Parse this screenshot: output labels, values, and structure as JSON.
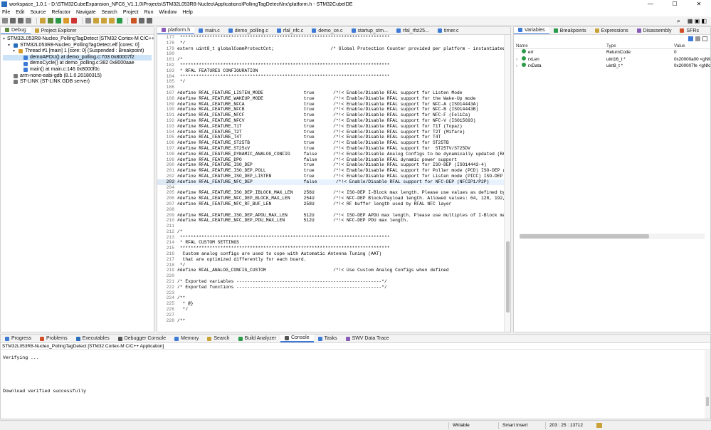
{
  "window": {
    "title": "workspace_1.0.1 - D:\\STM32CubeExpansion_NFC6_V1.1.0\\Projects\\STM32L053R8-Nucleo\\Applications\\PollingTagDetect\\Inc\\platform.h - STM32CubeIDE",
    "min": "—",
    "max": "☐",
    "close": "✕"
  },
  "menu": [
    "File",
    "Edit",
    "Source",
    "Refactor",
    "Navigate",
    "Search",
    "Project",
    "Run",
    "Window",
    "Help"
  ],
  "toolbar_icons": [
    "new-icon",
    "save-icon",
    "save-all-icon",
    "print-icon",
    "build-icon",
    "debug-icon",
    "resume-icon",
    "suspend-icon",
    "terminate-icon",
    "disconnect-icon",
    "step-into-icon",
    "step-over-icon",
    "step-return-icon",
    "run-icon",
    "external-tools-icon",
    "search-icon",
    "open-perspective-icon"
  ],
  "left_tabs": [
    {
      "label": "Debug",
      "icon_color": "#5b8a3a"
    },
    {
      "label": "Project Explorer",
      "icon_color": "#c9a23a"
    }
  ],
  "debug_tree": [
    {
      "indent": 0,
      "arrow": "▾",
      "icon_color": "#2a6ebb",
      "text": "STM32L053R8-Nucleo_PollingTagDetect [STM32 Cortex-M C/C++ Appli",
      "selected": false
    },
    {
      "indent": 1,
      "arrow": "▾",
      "icon_color": "#2a6ebb",
      "text": "STM32L053R8-Nucleo_PollingTagDetect.elf [cores: 0]",
      "selected": false
    },
    {
      "indent": 2,
      "arrow": "▾",
      "icon_color": "#d89a2a",
      "text": "Thread #1 [main] 1 [core: 0] (Suspended : Breakpoint)",
      "selected": false
    },
    {
      "indent": 3,
      "arrow": "",
      "icon_color": "#3d7ad6",
      "text": "demoAPDU() at demo_polling.c:703 0x80007f2",
      "selected": true
    },
    {
      "indent": 3,
      "arrow": "",
      "icon_color": "#3d7ad6",
      "text": "demoCycle() at demo_polling.c:382 0x8000aae",
      "selected": false
    },
    {
      "indent": 3,
      "arrow": "",
      "icon_color": "#3d7ad6",
      "text": "main() at main.c:146 0x8000f0c",
      "selected": false
    },
    {
      "indent": 1,
      "arrow": "",
      "icon_color": "#777777",
      "text": "arm-none-eabi-gdb (8.1.0.20180315)",
      "selected": false
    },
    {
      "indent": 1,
      "arrow": "",
      "icon_color": "#777777",
      "text": "ST-LINK (ST-LINK GDB server)",
      "selected": false
    }
  ],
  "editor_tabs": [
    {
      "label": "platform.h",
      "active": true
    },
    {
      "label": "main.c",
      "active": false
    },
    {
      "label": "demo_polling.c",
      "active": false
    },
    {
      "label": "rfal_nfc.c",
      "active": false
    },
    {
      "label": "demo_ce.c",
      "active": false
    },
    {
      "label": "startup_stm...",
      "active": false
    },
    {
      "label": "rfal_rfst25...",
      "active": false
    },
    {
      "label": "timer.c",
      "active": false
    }
  ],
  "editor": {
    "current_line": 203,
    "lines": [
      {
        "n": "177",
        "t": " ******************************************************************************",
        "c": "cm"
      },
      {
        "n": "178",
        "t": " */",
        "c": "cm"
      },
      {
        "n": "179",
        "t": "extern uint8_t globalCommProtectCnt;                     /* Global Protection Counter provided per platform - instantiated i",
        "c": "mix"
      },
      {
        "n": "180",
        "t": "",
        "c": ""
      },
      {
        "n": "181",
        "t": "/*",
        "c": "cm"
      },
      {
        "n": "182",
        "t": " ******************************************************************************",
        "c": "cm"
      },
      {
        "n": "183",
        "t": " * RFAL FEATURES CONFIGURATION",
        "c": "cm"
      },
      {
        "n": "184",
        "t": " ******************************************************************************",
        "c": "cm"
      },
      {
        "n": "185",
        "t": " */",
        "c": "cm"
      },
      {
        "n": "186",
        "t": "",
        "c": ""
      },
      {
        "n": "187",
        "t": "#define RFAL_FEATURE_LISTEN_MODE               true       /*!< Enable/Disable RFAL support for Listen Mode",
        "c": "def"
      },
      {
        "n": "188",
        "t": "#define RFAL_FEATURE_WAKEUP_MODE               true       /*!< Enable/Disable RFAL support for the Wake-Up mode",
        "c": "def"
      },
      {
        "n": "189",
        "t": "#define RFAL_FEATURE_NFCA                      true       /*!< Enable/Disable RFAL support for NFC-A (ISO14443A)",
        "c": "def"
      },
      {
        "n": "190",
        "t": "#define RFAL_FEATURE_NFCB                      true       /*!< Enable/Disable RFAL support for NFC-B (ISO14443B)",
        "c": "def"
      },
      {
        "n": "191",
        "t": "#define RFAL_FEATURE_NFCF                      true       /*!< Enable/Disable RFAL support for NFC-F (FeliCa)",
        "c": "def"
      },
      {
        "n": "192",
        "t": "#define RFAL_FEATURE_NFCV                      true       /*!< Enable/Disable RFAL support for NFC-V (ISO15693)",
        "c": "def"
      },
      {
        "n": "193",
        "t": "#define RFAL_FEATURE_T1T                       true       /*!< Enable/Disable RFAL support for T1T (Topaz)",
        "c": "def"
      },
      {
        "n": "194",
        "t": "#define RFAL_FEATURE_T2T                       true       /*!< Enable/Disable RFAL support for T2T (Mifare)",
        "c": "def"
      },
      {
        "n": "195",
        "t": "#define RFAL_FEATURE_T4T                       true       /*!< Enable/Disable RFAL support for T4T",
        "c": "def"
      },
      {
        "n": "196",
        "t": "#define RFAL_FEATURE_ST25TB                    true       /*!< Enable/Disable RFAL support for ST25TB",
        "c": "def"
      },
      {
        "n": "197",
        "t": "#define RFAL_FEATURE_ST25xV                    true       /*!< Enable/Disable RFAL support for  ST25TV/ST25DV",
        "c": "def"
      },
      {
        "n": "198",
        "t": "#define RFAL_FEATURE_DYNAMIC_ANALOG_CONFIG     false      /*!< Enable/Disable Analog Configs to be dynamically updated (RAM)",
        "c": "def"
      },
      {
        "n": "199",
        "t": "#define RFAL_FEATURE_DPO                       false      /*!< Enable/Disable RFAL dynamic power support",
        "c": "def"
      },
      {
        "n": "200",
        "t": "#define RFAL_FEATURE_ISO_DEP                   true       /*!< Enable/Disable RFAL support for ISO-DEP (ISO14443-4)",
        "c": "def"
      },
      {
        "n": "201",
        "t": "#define RFAL_FEATURE_ISO_DEP_POLL              true       /*!< Enable/Disable RFAL support for Poller mode (PCD) ISO-DEP (ISO",
        "c": "def"
      },
      {
        "n": "202",
        "t": "#define RFAL_FEATURE_ISO_DEP_LISTEN            true       /*!< Enable/Disable RFAL support for Listen mode (PICC) ISO-DEP (IS",
        "c": "def"
      },
      {
        "n": "203",
        "t": "#define RFAL_FEATURE_NFC_DEP                   false       /*!< Enable/Disable RFAL support for NFC-DEP (NFCIP1/P2P)",
        "c": "def"
      },
      {
        "n": "204",
        "t": "",
        "c": ""
      },
      {
        "n": "205",
        "t": "#define RFAL_FEATURE_ISO_DEP_IBLOCK_MAX_LEN    256U       /*!< ISO-DEP I-Block max length. Please use values as defined by rf",
        "c": "def"
      },
      {
        "n": "206",
        "t": "#define RFAL_FEATURE_NFC_DEP_BLOCK_MAX_LEN     254U       /*!< NFC-DEP Block/Payload length. Allowed values: 64, 128, 192, 25",
        "c": "def"
      },
      {
        "n": "207",
        "t": "#define RFAL_FEATURE_NFC_RF_BUF_LEN            258U       /*!< RF buffer length used by RFAL NFC layer",
        "c": "def"
      },
      {
        "n": "208",
        "t": "",
        "c": ""
      },
      {
        "n": "209",
        "t": "#define RFAL_FEATURE_ISO_DEP_APDU_MAX_LEN      512U       /*!< ISO-DEP APDU max length. Please use multiples of I-Block max l",
        "c": "def"
      },
      {
        "n": "210",
        "t": "#define RFAL_FEATURE_NFC_DEP_PDU_MAX_LEN       512U       /*!< NFC-DEP PDU max length.",
        "c": "def"
      },
      {
        "n": "211",
        "t": "",
        "c": ""
      },
      {
        "n": "212",
        "t": "/*",
        "c": "cm"
      },
      {
        "n": "213",
        "t": " ******************************************************************************",
        "c": "cm"
      },
      {
        "n": "214",
        "t": " * RFAL CUSTOM SETTINGS",
        "c": "cm"
      },
      {
        "n": "215",
        "t": " ******************************************************************************",
        "c": "cm"
      },
      {
        "n": "216",
        "t": "  Custom analog configs are used to cope with Automatic Antenna Tuning (AAT)",
        "c": "cm"
      },
      {
        "n": "217",
        "t": "  that are optimized differently for each board.",
        "c": "cm"
      },
      {
        "n": "218",
        "t": " */",
        "c": "cm"
      },
      {
        "n": "219",
        "t": "#define RFAL_ANALOG_CONFIG_CUSTOM                         /*!< Use Custom Analog Configs when defined",
        "c": "def"
      },
      {
        "n": "220",
        "t": "",
        "c": ""
      },
      {
        "n": "221",
        "t": "/* Exported variables ------------------------------------------------------*/",
        "c": "cm"
      },
      {
        "n": "222",
        "t": "/* Exported functions ------------------------------------------------------*/",
        "c": "cm"
      },
      {
        "n": "223",
        "t": "",
        "c": ""
      },
      {
        "n": "224",
        "t": "/**",
        "c": "cm"
      },
      {
        "n": "225",
        "t": "  * @}",
        "c": "cm"
      },
      {
        "n": "226",
        "t": "  */",
        "c": "cm"
      },
      {
        "n": "227",
        "t": "",
        "c": ""
      },
      {
        "n": "228",
        "t": "/**",
        "c": "cm"
      }
    ]
  },
  "right_tabs": [
    {
      "label": "Variables",
      "icon_color": "#3d7ad6",
      "active": true
    },
    {
      "label": "Breakpoints",
      "icon_color": "#2a9a4a",
      "active": false
    },
    {
      "label": "Expressions",
      "icon_color": "#c9a23a",
      "active": false
    },
    {
      "label": "Disassembly",
      "icon_color": "#8a5ab8",
      "active": false
    },
    {
      "label": "SFRs",
      "icon_color": "#d0502a",
      "active": false
    }
  ],
  "variables": {
    "headers": [
      "Name",
      "Type",
      "Value"
    ],
    "rows": [
      {
        "arrow": "",
        "name": "err",
        "type": "ReturnCode",
        "value": "0"
      },
      {
        "arrow": "›",
        "name": "rxLen",
        "type": "uint16_t *",
        "value": "0x20000a00 <gNfc"
      },
      {
        "arrow": "›",
        "name": "rxData",
        "type": "uint8_t *",
        "value": "0x200007fe <gNfc"
      }
    ]
  },
  "bottom_tabs": [
    {
      "label": "Progress",
      "icon_color": "#3d7ad6"
    },
    {
      "label": "Problems",
      "icon_color": "#d0502a"
    },
    {
      "label": "Executables",
      "icon_color": "#2a6ebb"
    },
    {
      "label": "Debugger Console",
      "icon_color": "#555555"
    },
    {
      "label": "Memory",
      "icon_color": "#3d7ad6"
    },
    {
      "label": "Search",
      "icon_color": "#c9a23a"
    },
    {
      "label": "Build Analyzer",
      "icon_color": "#2a9a4a"
    },
    {
      "label": "Console",
      "icon_color": "#555555"
    },
    {
      "label": "Tasks",
      "icon_color": "#3d7ad6"
    },
    {
      "label": "SWV Data Trace",
      "icon_color": "#8a5ab8"
    }
  ],
  "console": {
    "title": "STM32L053R8-Nucleo_PollingTagDetect [STM32 Cortex-M C/C++ Application]",
    "lines": [
      "",
      "Verifying ...",
      "",
      "",
      "",
      "",
      "",
      "Download verified successfully"
    ]
  },
  "status": {
    "writable": "Writable",
    "insert": "Smart Insert",
    "position": "203 : 25 : 13712"
  }
}
